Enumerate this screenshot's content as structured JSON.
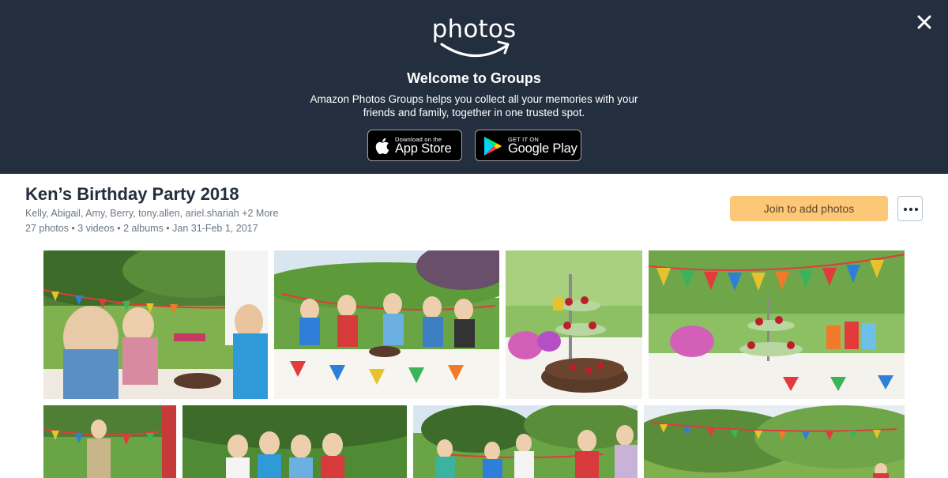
{
  "banner": {
    "logo_text": "photos",
    "title": "Welcome to Groups",
    "description": "Amazon Photos Groups helps you collect all your memories with your friends and family, together in one trusted spot.",
    "close_icon": "close-icon",
    "app_store": {
      "small": "Download on the",
      "big": "App Store",
      "icon": "apple-icon"
    },
    "google_play": {
      "small": "GET IT ON",
      "big": "Google Play",
      "icon": "google-play-icon"
    }
  },
  "group": {
    "title": "Ken’s Birthday Party 2018",
    "members": "Kelly, Abigail, Amy, Berry, tony.allen, ariel.shariah +2 More",
    "meta": "27 photos • 3 videos • 2 albums • Jan 31-Feb 1, 2017",
    "join_label": "Join to add photos",
    "more_icon": "more-options-icon"
  },
  "colors": {
    "banner_bg": "#232f3e",
    "join_button": "#fdc778",
    "secondary_text": "#6b7785"
  },
  "photos": [
    {
      "name": "photo-children-blowing-candles"
    },
    {
      "name": "photo-children-blowing-party-horns"
    },
    {
      "name": "photo-cake-stand-table"
    },
    {
      "name": "photo-party-table-bunting"
    },
    {
      "name": "photo-sack-race"
    },
    {
      "name": "photo-children-group"
    },
    {
      "name": "photo-children-running"
    },
    {
      "name": "photo-garden-bunting"
    }
  ]
}
